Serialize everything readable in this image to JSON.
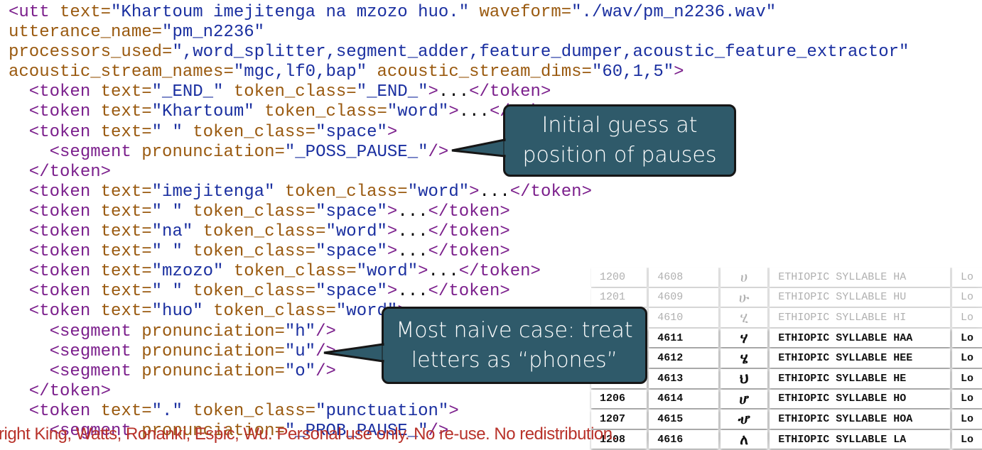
{
  "code_lines": [
    [
      [
        "t",
        "<utt "
      ],
      [
        "a",
        "text="
      ],
      [
        "v",
        "\"Khartoum imejitenga na mzozo huo.\" "
      ],
      [
        "a",
        "waveform="
      ],
      [
        "v",
        "\"./wav/pm_n2236.wav\""
      ]
    ],
    [
      [
        "a",
        "utterance_name="
      ],
      [
        "v",
        "\"pm_n2236\""
      ]
    ],
    [
      [
        "a",
        "processors_used="
      ],
      [
        "v",
        "\",word_splitter,segment_adder,feature_dumper,acoustic_feature_extractor\""
      ]
    ],
    [
      [
        "a",
        "acoustic_stream_names="
      ],
      [
        "v",
        "\"mgc,lf0,bap\" "
      ],
      [
        "a",
        "acoustic_stream_dims="
      ],
      [
        "v",
        "\"60,1,5\""
      ],
      [
        "t",
        ">"
      ]
    ],
    [
      [
        "t",
        "  <token "
      ],
      [
        "a",
        "text="
      ],
      [
        "v",
        "\"_END_\" "
      ],
      [
        "a",
        "token_class="
      ],
      [
        "v",
        "\"_END_\""
      ],
      [
        "t",
        ">"
      ],
      [
        "p",
        "..."
      ],
      [
        "t",
        "</token>"
      ]
    ],
    [
      [
        "t",
        "  <token "
      ],
      [
        "a",
        "text="
      ],
      [
        "v",
        "\"Khartoum\" "
      ],
      [
        "a",
        "token_class="
      ],
      [
        "v",
        "\"word\""
      ],
      [
        "t",
        ">"
      ],
      [
        "p",
        "..."
      ],
      [
        "t",
        "</token>"
      ]
    ],
    [
      [
        "t",
        "  <token "
      ],
      [
        "a",
        "text="
      ],
      [
        "v",
        "\" \" "
      ],
      [
        "a",
        "token_class="
      ],
      [
        "v",
        "\"space\""
      ],
      [
        "t",
        ">"
      ]
    ],
    [
      [
        "t",
        "    <segment "
      ],
      [
        "a",
        "pronunciation="
      ],
      [
        "v",
        "\"_POSS_PAUSE_\""
      ],
      [
        "t",
        "/>"
      ]
    ],
    [
      [
        "t",
        "  </token>"
      ]
    ],
    [
      [
        "t",
        "  <token "
      ],
      [
        "a",
        "text="
      ],
      [
        "v",
        "\"imejitenga\" "
      ],
      [
        "a",
        "token_class="
      ],
      [
        "v",
        "\"word\""
      ],
      [
        "t",
        ">"
      ],
      [
        "p",
        "..."
      ],
      [
        "t",
        "</token>"
      ]
    ],
    [
      [
        "t",
        "  <token "
      ],
      [
        "a",
        "text="
      ],
      [
        "v",
        "\" \" "
      ],
      [
        "a",
        "token_class="
      ],
      [
        "v",
        "\"space\""
      ],
      [
        "t",
        ">"
      ],
      [
        "p",
        "..."
      ],
      [
        "t",
        "</token>"
      ]
    ],
    [
      [
        "t",
        "  <token "
      ],
      [
        "a",
        "text="
      ],
      [
        "v",
        "\"na\" "
      ],
      [
        "a",
        "token_class="
      ],
      [
        "v",
        "\"word\""
      ],
      [
        "t",
        ">"
      ],
      [
        "p",
        "..."
      ],
      [
        "t",
        "</token>"
      ]
    ],
    [
      [
        "t",
        "  <token "
      ],
      [
        "a",
        "text="
      ],
      [
        "v",
        "\" \" "
      ],
      [
        "a",
        "token_class="
      ],
      [
        "v",
        "\"space\""
      ],
      [
        "t",
        ">"
      ],
      [
        "p",
        "..."
      ],
      [
        "t",
        "</token>"
      ]
    ],
    [
      [
        "t",
        "  <token "
      ],
      [
        "a",
        "text="
      ],
      [
        "v",
        "\"mzozo\" "
      ],
      [
        "a",
        "token_class="
      ],
      [
        "v",
        "\"word\""
      ],
      [
        "t",
        ">"
      ],
      [
        "p",
        "..."
      ],
      [
        "t",
        "</token>"
      ]
    ],
    [
      [
        "t",
        "  <token "
      ],
      [
        "a",
        "text="
      ],
      [
        "v",
        "\" \" "
      ],
      [
        "a",
        "token_class="
      ],
      [
        "v",
        "\"space\""
      ],
      [
        "t",
        ">"
      ],
      [
        "p",
        "..."
      ],
      [
        "t",
        "</token>"
      ]
    ],
    [
      [
        "t",
        "  <token "
      ],
      [
        "a",
        "text="
      ],
      [
        "v",
        "\"huo\" "
      ],
      [
        "a",
        "token_class="
      ],
      [
        "v",
        "\"word\""
      ],
      [
        "t",
        ">"
      ]
    ],
    [
      [
        "t",
        "    <segment "
      ],
      [
        "a",
        "pronunciation="
      ],
      [
        "v",
        "\"h\""
      ],
      [
        "t",
        "/>"
      ]
    ],
    [
      [
        "t",
        "    <segment "
      ],
      [
        "a",
        "pronunciation="
      ],
      [
        "v",
        "\"u\""
      ],
      [
        "t",
        "/>"
      ]
    ],
    [
      [
        "t",
        "    <segment "
      ],
      [
        "a",
        "pronunciation="
      ],
      [
        "v",
        "\"o\""
      ],
      [
        "t",
        "/>"
      ]
    ],
    [
      [
        "t",
        "  </token>"
      ]
    ],
    [
      [
        "t",
        "  <token "
      ],
      [
        "a",
        "text="
      ],
      [
        "v",
        "\".\" "
      ],
      [
        "a",
        "token_class="
      ],
      [
        "v",
        "\"punctuation\""
      ],
      [
        "t",
        ">"
      ]
    ],
    [
      [
        "t",
        "    <segment "
      ],
      [
        "a",
        "pronunciation="
      ],
      [
        "v",
        "\"_PROB_PAUSE_\""
      ],
      [
        "t",
        "/>"
      ]
    ]
  ],
  "unicode_table": {
    "rows": [
      {
        "hex": "1200",
        "dec": "4608",
        "glyph": "ሀ",
        "name": "ETHIOPIC SYLLABLE HA",
        "category": "Lo",
        "faded": true
      },
      {
        "hex": "1201",
        "dec": "4609",
        "glyph": "ሁ",
        "name": "ETHIOPIC SYLLABLE HU",
        "category": "Lo",
        "faded": true
      },
      {
        "hex": "",
        "dec": "4610",
        "glyph": "ሂ",
        "name": "ETHIOPIC SYLLABLE HI",
        "category": "Lo",
        "faded": true
      },
      {
        "hex": "",
        "dec": "4611",
        "glyph": "ሃ",
        "name": "ETHIOPIC SYLLABLE HAA",
        "category": "Lo",
        "faded": false
      },
      {
        "hex": "",
        "dec": "4612",
        "glyph": "ሄ",
        "name": "ETHIOPIC SYLLABLE HEE",
        "category": "Lo",
        "faded": false
      },
      {
        "hex": "",
        "dec": "4613",
        "glyph": "ህ",
        "name": "ETHIOPIC SYLLABLE HE",
        "category": "Lo",
        "faded": false
      },
      {
        "hex": "1206",
        "dec": "4614",
        "glyph": "ሆ",
        "name": "ETHIOPIC SYLLABLE HO",
        "category": "Lo",
        "faded": false
      },
      {
        "hex": "1207",
        "dec": "4615",
        "glyph": "ሇ",
        "name": "ETHIOPIC SYLLABLE HOA",
        "category": "Lo",
        "faded": false
      },
      {
        "hex": "1208",
        "dec": "4616",
        "glyph": "ለ",
        "name": "ETHIOPIC SYLLABLE LA",
        "category": "Lo",
        "faded": false
      }
    ]
  },
  "callouts": [
    {
      "lines": [
        "Initial guess at",
        "position of pauses"
      ]
    },
    {
      "lines": [
        "Most naive case: treat",
        "letters as “phones”"
      ]
    }
  ],
  "footer": {
    "copyright": "right King, Watts, Ronanki, Espic, Wu. Personal use only. No re-use. No redistribution."
  },
  "colors": {
    "tag": "#7b1f8c",
    "attribute": "#9a5a10",
    "value": "#1a2fa0",
    "callout": "#2f5a6a",
    "footer": "#b8322a"
  }
}
